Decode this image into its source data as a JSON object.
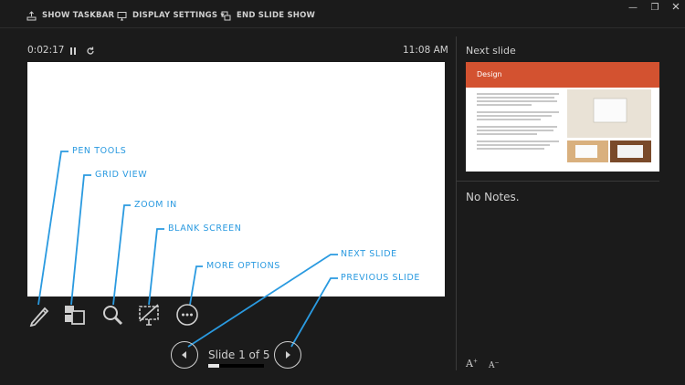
{
  "topbar": {
    "show_taskbar": "SHOW TASKBAR",
    "display_settings": "DISPLAY SETTINGS ▾",
    "end_slide_show": "END SLIDE SHOW"
  },
  "window_controls": {
    "minimize": "—",
    "restore": "❐"
  },
  "presenter": {
    "timer": "0:02:17",
    "clock": "11:08 AM",
    "slide_count": "Slide 1 of 5",
    "progress_fraction": 0.2
  },
  "callouts": {
    "pen_tools": "PEN TOOLS",
    "grid_view": "GRID VIEW",
    "zoom_in": "ZOOM IN",
    "blank_screen": "BLANK SCREEN",
    "more_options": "MORE OPTIONS",
    "next_slide": "NEXT SLIDE",
    "previous_slide": "PREVIOUS SLIDE"
  },
  "right_pane": {
    "next_slide_label": "Next slide",
    "thumb_title": "Design",
    "notes_text": "No Notes."
  },
  "colors": {
    "background": "#1b1b1b",
    "accent_blue": "#2a9ae0",
    "thumb_band": "#d35230"
  },
  "icons": [
    "layout-icon",
    "monitor-icon",
    "end-show-icon",
    "pause-icon",
    "refresh-icon",
    "pen-icon",
    "grid-icon",
    "zoom-icon",
    "blank-screen-icon",
    "more-options-icon",
    "chevron-left-icon",
    "chevron-right-icon"
  ]
}
